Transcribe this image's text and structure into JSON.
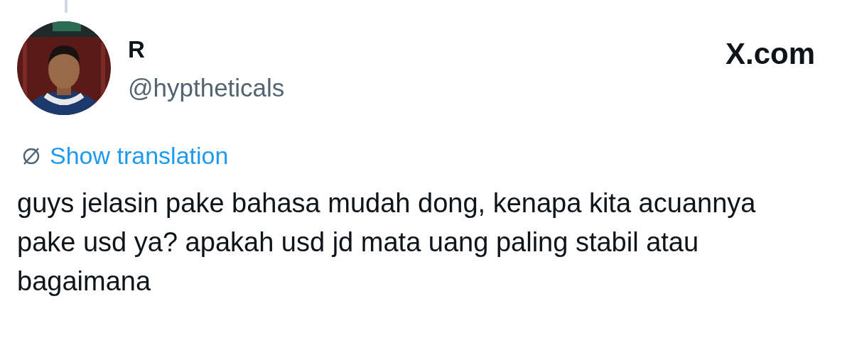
{
  "post": {
    "display_name": "R",
    "handle": "@hyptheticals",
    "site": "X.com",
    "translation_link": "Show translation",
    "text": "guys jelasin pake bahasa mudah dong, kenapa kita acuannya pake usd ya? apakah usd jd mata uang paling stabil atau bagaimana"
  }
}
